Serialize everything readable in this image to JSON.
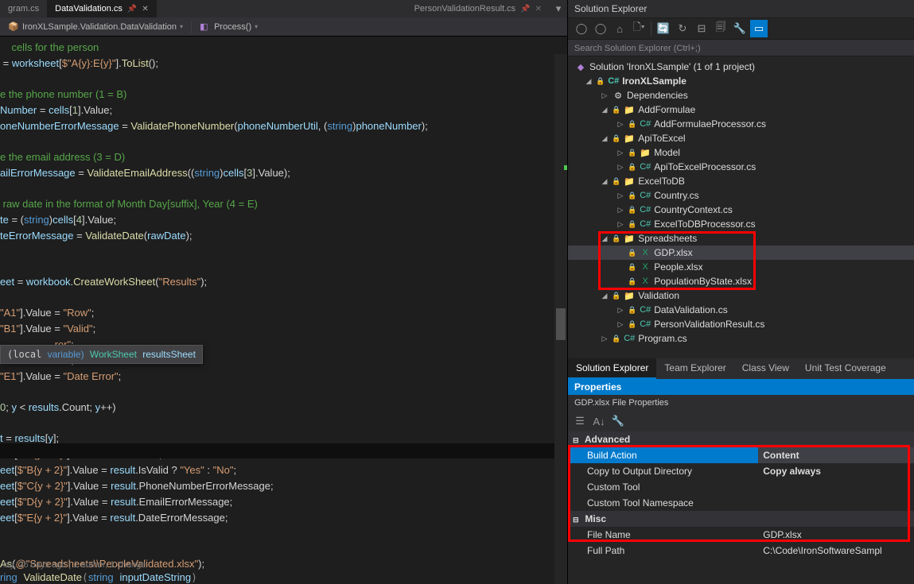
{
  "tabs": {
    "left": "gram.cs",
    "active": "DataValidation.cs",
    "right": "PersonValidationResult.cs"
  },
  "breadcrumb": {
    "namespace": "IronXLSample.Validation.DataValidation",
    "method": "Process()"
  },
  "tooltip": {
    "kind": "variable)",
    "type": "WorkSheet",
    "name": "resultsSheet"
  },
  "code": {
    "l1": "    cells for the person",
    "l2": " = worksheet[$\"A{y}:E{y}\"].ToList();",
    "l3": "",
    "l4": "e the phone number (1 = B)",
    "l5": "Number = cells[1].Value;",
    "l6_a": "oneNumberErrorMessage = ValidatePhoneNumber(phoneNumberUtil, (",
    "l6_kw": "string",
    "l6_b": ")phoneNumber);",
    "l7": "",
    "l8": "e the email address (3 = D)",
    "l9_a": "ailErrorMessage = ValidateEmailAddress((",
    "l9_b": ")cells[3].Value);",
    "l10": "",
    "l11": " raw date in the format of Month Day[suffix], Year (4 = E)",
    "l12_a": "te = (",
    "l12_b": ")cells[4].Value;",
    "l13": "teErrorMessage = ValidateDate(rawDate);",
    "l14": "",
    "l15": "",
    "l16": "eet = workbook.CreateWorkSheet(\"Results\");",
    "l17": "",
    "l18": "\"A1\"].Value = \"Row\";",
    "l19": "\"B1\"].Value = \"Valid\";",
    "l20": "                   ror\";",
    "l21": "                   ror\";",
    "l22": "\"E1\"].Value = \"Date Error\";",
    "l23": "",
    "l24": "0; y < results.Count; y++)",
    "l25": "",
    "l26": "t = results[y];",
    "l27": "eet[$\"A{y + 2}\"].Value = result.Row;",
    "l28": "eet[$\"B{y + 2}\"].Value = result.IsValid ? \"Yes\" : \"No\";",
    "l29": "eet[$\"C{y + 2}\"].Value = result.PhoneNumberErrorMessage;",
    "l30": "eet[$\"D{y + 2}\"].Value = result.EmailErrorMessage;",
    "l31": "eet[$\"E{y + 2}\"].Value = result.DateErrorMessage;",
    "l32": "",
    "l33": "",
    "l34": "As(@\"Spreadsheets\\\\PeopleValidated.xlsx\");",
    "l35": ""
  },
  "blame": "lay, 26 days ago | 1 author, 1 change",
  "partial_bottom": "ring ValidateDate(string inputDateString)",
  "solution_explorer": {
    "title": "Solution Explorer",
    "search_placeholder": "Search Solution Explorer (Ctrl+;)",
    "root": "Solution 'IronXLSample' (1 of 1 project)",
    "project": "IronXLSample",
    "deps": "Dependencies",
    "folders": {
      "addformulae": "AddFormulae",
      "addformulae_file": "AddFormulaeProcessor.cs",
      "apitoexcel": "ApiToExcel",
      "model": "Model",
      "apitoexcel_file": "ApiToExcelProcessor.cs",
      "exceltodb": "ExcelToDB",
      "country": "Country.cs",
      "countryctx": "CountryContext.cs",
      "exceltodbproc": "ExcelToDBProcessor.cs",
      "spreadsheets": "Spreadsheets",
      "gdp": "GDP.xlsx",
      "people": "People.xlsx",
      "pop": "PopulationByState.xlsx",
      "validation": "Validation",
      "datavalidation": "DataValidation.cs",
      "pvr": "PersonValidationResult.cs",
      "program": "Program.cs"
    }
  },
  "panel_tabs": {
    "a": "Solution Explorer",
    "b": "Team Explorer",
    "c": "Class View",
    "d": "Unit Test Coverage"
  },
  "properties": {
    "title": "Properties",
    "subtitle": "GDP.xlsx  File Properties",
    "cat_advanced": "Advanced",
    "build_action": {
      "label": "Build Action",
      "value": "Content"
    },
    "copy_out": {
      "label": "Copy to Output Directory",
      "value": "Copy always"
    },
    "custom_tool": {
      "label": "Custom Tool",
      "value": ""
    },
    "custom_tool_ns": {
      "label": "Custom Tool Namespace",
      "value": ""
    },
    "cat_misc": "Misc",
    "file_name": {
      "label": "File Name",
      "value": "GDP.xlsx"
    },
    "full_path": {
      "label": "Full Path",
      "value": "C:\\Code\\IronSoftwareSampl"
    }
  }
}
